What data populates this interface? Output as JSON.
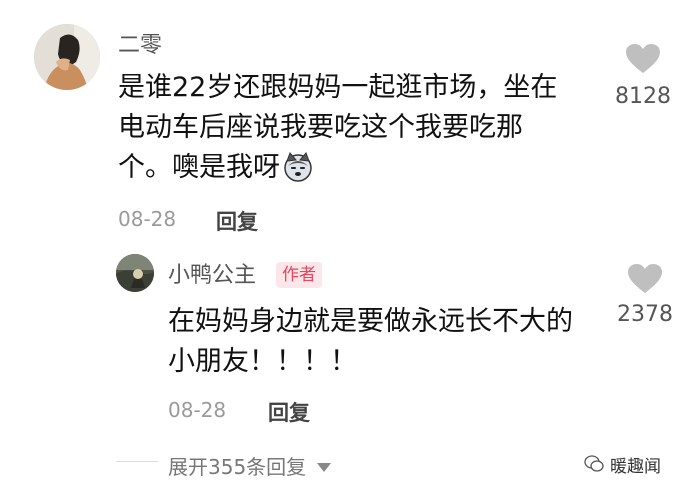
{
  "comment": {
    "username": "二零",
    "lines": [
      "是谁22岁还跟妈妈一起逛市场，坐在",
      "电动车后座说我要吃这个我要吃那",
      "个。噢是我呀"
    ],
    "date": "08-28",
    "reply_label": "回复",
    "likes": "8128"
  },
  "reply": {
    "username": "小鸭公主",
    "badge": "作者",
    "lines": [
      "在妈妈身边就是要做永远长不大的",
      "小朋友！！！！"
    ],
    "date": "08-28",
    "reply_label": "回复",
    "likes": "2378"
  },
  "expand": {
    "label": "展开355条回复"
  },
  "watermark": {
    "text": "暖趣闻"
  },
  "colors": {
    "badge_bg": "#fde6ea",
    "badge_text": "#e8455f",
    "heart": "#bfbfbf"
  }
}
